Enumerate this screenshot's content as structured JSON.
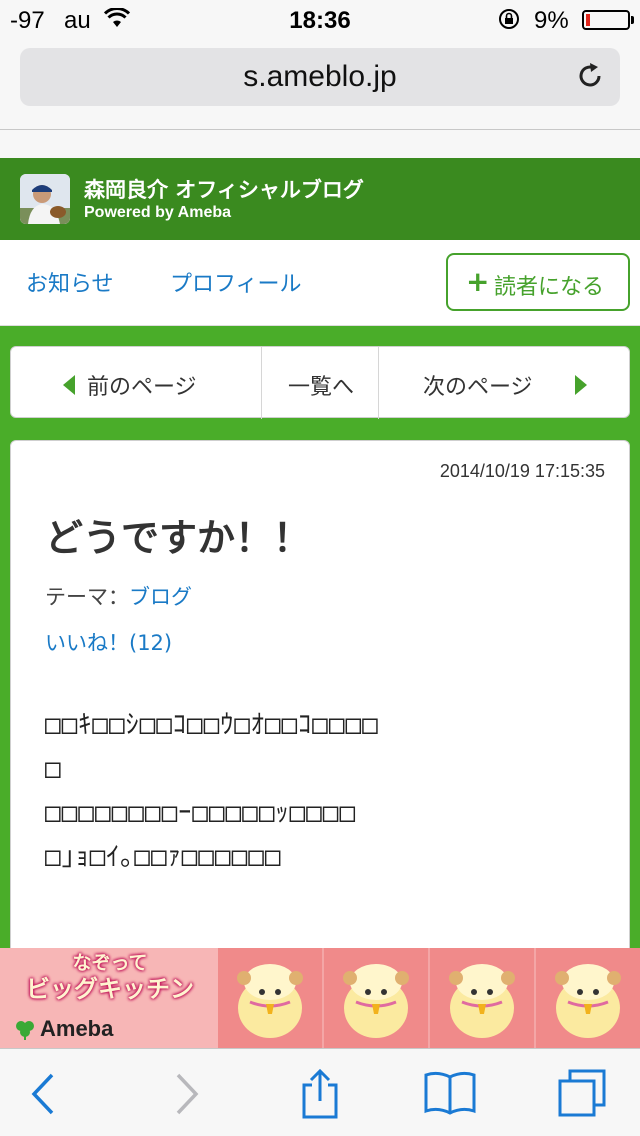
{
  "status_bar": {
    "signal": "-97",
    "carrier": "au",
    "time": "18:36",
    "battery_percent": "9%",
    "battery_level": 0.09,
    "battery_color": "#e0261c"
  },
  "browser": {
    "url": "s.ameblo.jp",
    "reload_icon": "reload-icon"
  },
  "blog": {
    "title": "森岡良介 オフィシャルブログ",
    "subtitle": "Powered by Ameba",
    "header_color": "#3a8a1f"
  },
  "nav": {
    "info": "お知らせ",
    "profile": "プロフィール",
    "reader_plus": "+",
    "reader": "読者になる"
  },
  "pager": {
    "prev": "前のページ",
    "list": "一覧へ",
    "next": "次のページ"
  },
  "article": {
    "date": "2014/10/19 17:15:35",
    "title": "どうですか！！",
    "theme_label": "テーマ：",
    "theme_link": "ブログ",
    "likes": "いいね！(12)",
    "body_lines": [
      "□□ｷ□□ｼ□□ｺ□□ｳ□ｵ□□ｺ□□□□",
      "□",
      "□□□□□□□□ｰ□□□□□ｯ□□□□",
      "□｣ｮ□ｲ｡□□ｧ□□□□□□"
    ]
  },
  "ad": {
    "title_line1": "なぞって",
    "title_line2": "ビッグキッチン",
    "brand": "Ameba"
  },
  "toolbar": {
    "back_icon": "back-icon",
    "forward_icon": "forward-icon",
    "share_icon": "share-icon",
    "bookmarks_icon": "bookmarks-icon",
    "tabs_icon": "tabs-icon"
  },
  "colors": {
    "accent_green": "#4aad29",
    "link_blue": "#1a7ac6",
    "ios_blue": "#1a7ad4"
  }
}
